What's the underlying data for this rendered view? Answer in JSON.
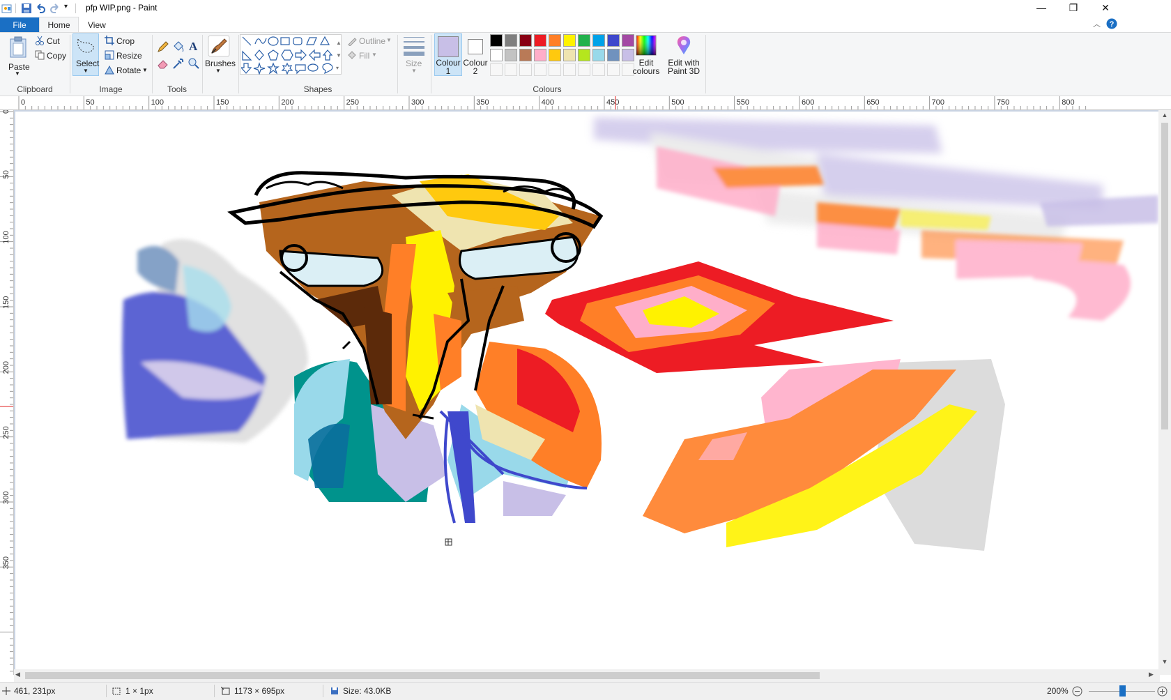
{
  "window": {
    "title": "pfp WIP.png - Paint",
    "minimize": "—",
    "restore": "❐",
    "close": "✕"
  },
  "tabs": {
    "file": "File",
    "home": "Home",
    "view": "View"
  },
  "clipboard": {
    "paste": "Paste",
    "cut": "Cut",
    "copy": "Copy",
    "label": "Clipboard"
  },
  "image": {
    "select": "Select",
    "crop": "Crop",
    "resize": "Resize",
    "rotate": "Rotate",
    "label": "Image"
  },
  "tools": {
    "label": "Tools"
  },
  "brushes": {
    "label": "Brushes"
  },
  "shapes": {
    "outline": "Outline",
    "fill": "Fill",
    "label": "Shapes"
  },
  "size": {
    "label": "Size"
  },
  "colours": {
    "colour1": "Colour 1",
    "colour2": "Colour 2",
    "edit": "Edit colours",
    "edit3d": "Edit with Paint 3D",
    "label": "Colours",
    "colour1_value": "#c8bfe7",
    "colour2_value": "#ffffff",
    "palette": [
      "#000000",
      "#7f7f7f",
      "#880015",
      "#ed1c24",
      "#ff7f27",
      "#fff200",
      "#22b14c",
      "#00a2e8",
      "#3f48cc",
      "#a349a4",
      "#ffffff",
      "#c3c3c3",
      "#b97a57",
      "#ffaec9",
      "#ffc90e",
      "#efe4b0",
      "#b5e61d",
      "#99d9ea",
      "#7092be",
      "#c8bfe7"
    ]
  },
  "ruler": {
    "h": [
      "0",
      "50",
      "100",
      "150",
      "200",
      "250",
      "300",
      "350",
      "400",
      "450",
      "500",
      "550",
      "600",
      "650",
      "700",
      "750",
      "800"
    ],
    "v": [
      "0",
      "50",
      "100",
      "150",
      "200",
      "250",
      "300",
      "350"
    ]
  },
  "status": {
    "cursor": "461, 231px",
    "selection": "1 × 1px",
    "canvas_size": "1173 × 695px",
    "file_size": "Size: 43.0KB",
    "zoom": "200%"
  }
}
